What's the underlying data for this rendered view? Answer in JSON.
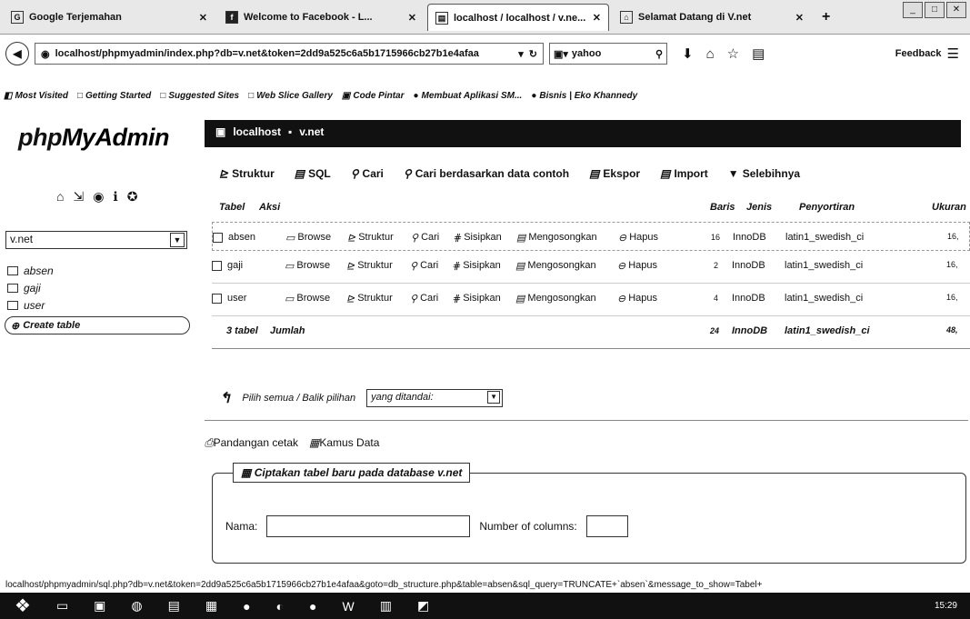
{
  "tabs": [
    {
      "label": "Google Terjemahan",
      "icon": "google-translate-icon",
      "active": false
    },
    {
      "label": "Welcome to Facebook - L...",
      "icon": "facebook-icon",
      "active": false
    },
    {
      "label": "localhost / localhost / v.ne...",
      "icon": "phpmyadmin-icon",
      "active": true
    },
    {
      "label": "Selamat Datang di V.net",
      "icon": "page-icon",
      "active": false
    }
  ],
  "nav": {
    "url": "localhost/phpmyadmin/index.php?db=v.net&token=2dd9a525c6a5b1715966cb27b1e4afaa",
    "search": "yahoo",
    "feedback": "Feedback"
  },
  "bookmarks": [
    "Most Visited",
    "Getting Started",
    "Suggested Sites",
    "Web Slice Gallery",
    "Code Pintar",
    "Membuat Aplikasi SM...",
    "Bisnis | Eko Khannedy"
  ],
  "sidebar": {
    "logo_php": "php",
    "logo_myadmin": "MyAdmin",
    "db_selected": "v.net",
    "tables": [
      "absen",
      "gaji",
      "user"
    ],
    "create_table": "Create table"
  },
  "breadcrumb": {
    "server": "localhost",
    "db": "v.net"
  },
  "menu": [
    "Struktur",
    "SQL",
    "Cari",
    "Cari berdasarkan data contoh",
    "Ekspor",
    "Import",
    "Selebihnya"
  ],
  "table_headers": {
    "tabel": "Tabel",
    "aksi": "Aksi",
    "baris": "Baris",
    "jenis": "Jenis",
    "penyortiran": "Penyortiran",
    "ukuran": "Ukuran"
  },
  "actions": {
    "browse": "Browse",
    "struktur": "Struktur",
    "cari": "Cari",
    "sisipkan": "Sisipkan",
    "kosongkan": "Mengosongkan",
    "hapus": "Hapus"
  },
  "rows": [
    {
      "name": "absen",
      "baris": "16",
      "jenis": "InnoDB",
      "collation": "latin1_swedish_ci",
      "size": "16,"
    },
    {
      "name": "gaji",
      "baris": "2",
      "jenis": "InnoDB",
      "collation": "latin1_swedish_ci",
      "size": "16,"
    },
    {
      "name": "user",
      "baris": "4",
      "jenis": "InnoDB",
      "collation": "latin1_swedish_ci",
      "size": "16,"
    }
  ],
  "total": {
    "label": "3 tabel",
    "sum_label": "Jumlah",
    "baris": "24",
    "jenis": "InnoDB",
    "collation": "latin1_swedish_ci",
    "size": "48,"
  },
  "bulk": {
    "select_all": "Pilih semua / Balik pilihan",
    "with_selected": "yang ditandai:"
  },
  "links": {
    "print": "Pandangan cetak",
    "dict": "Kamus Data"
  },
  "create": {
    "legend": "Ciptakan tabel baru pada database v.net",
    "name_label": "Nama:",
    "cols_label": "Number of columns:"
  },
  "status_url": "localhost/phpmyadmin/sql.php?db=v.net&token=2dd9a525c6a5b1715966cb27b1e4afaa&goto=db_structure.php&table=absen&sql_query=TRUNCATE+`absen`&message_to_show=Tabel+",
  "clock": "15:29"
}
